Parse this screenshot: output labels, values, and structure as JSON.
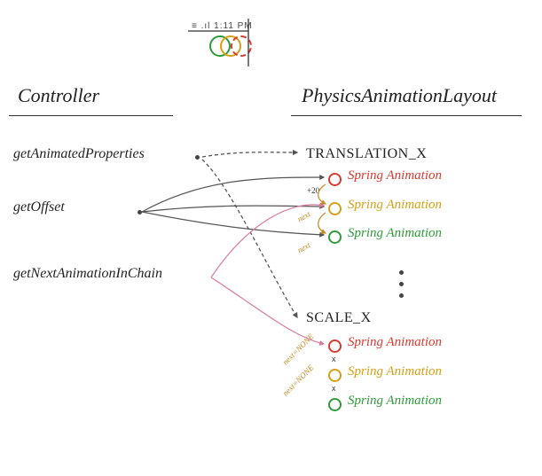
{
  "statusbar": {
    "text": "≡ .ıl 1:11 PM"
  },
  "columns": {
    "left": {
      "title": "Controller"
    },
    "right": {
      "title": "PhysicsAnimationLayout"
    }
  },
  "methods": {
    "getAnimatedProperties": "getAnimatedProperties",
    "getOffset": "getOffset",
    "getNextAnimationInChain": "getNextAnimationInChain"
  },
  "properties": {
    "translationX": "TRANSLATION_X",
    "scaleX": "SCALE_X"
  },
  "springs": {
    "translation": [
      {
        "label": "Spring Animation",
        "color": "red"
      },
      {
        "label": "Spring Animation",
        "color": "orange"
      },
      {
        "label": "Spring Animation",
        "color": "green"
      }
    ],
    "scale": [
      {
        "label": "Spring Animation",
        "color": "red"
      },
      {
        "label": "Spring Animation",
        "color": "orange"
      },
      {
        "label": "Spring Animation",
        "color": "green"
      }
    ]
  },
  "annotations": {
    "offsetValue": "+20",
    "nextLabels": [
      "next",
      "next",
      "next=NONE",
      "next=NONE"
    ]
  }
}
